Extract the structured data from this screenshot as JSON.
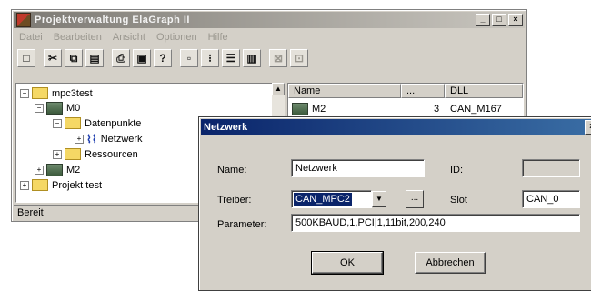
{
  "main_window": {
    "title": "Projektverwaltung ElaGraph II",
    "controls": {
      "minimize": "_",
      "maximize": "□",
      "close": "×"
    },
    "menu": [
      "Datei",
      "Bearbeiten",
      "Ansicht",
      "Optionen",
      "Hilfe"
    ],
    "toolbar_icons": [
      {
        "name": "new-icon",
        "glyph": "□"
      },
      {
        "name": "cut-icon",
        "glyph": "✂"
      },
      {
        "name": "copy-icon",
        "glyph": "⧉"
      },
      {
        "name": "paste-icon",
        "glyph": "▤"
      },
      {
        "name": "print-icon",
        "glyph": "⎙"
      },
      {
        "name": "print-preview-icon",
        "glyph": "▣"
      },
      {
        "name": "help-icon",
        "glyph": "?"
      },
      {
        "name": "large-icons-view-icon",
        "glyph": "▫"
      },
      {
        "name": "small-icons-view-icon",
        "glyph": "⁝"
      },
      {
        "name": "list-view-icon",
        "glyph": "☰"
      },
      {
        "name": "details-view-icon",
        "glyph": "▥"
      },
      {
        "name": "disabled-tool-1-icon",
        "glyph": "⊠"
      },
      {
        "name": "disabled-tool-2-icon",
        "glyph": "⊡"
      }
    ],
    "tree": [
      {
        "label": "mpc3test",
        "icon": "folder-icon",
        "expander": "−"
      },
      {
        "label": "M0",
        "icon": "computer-icon",
        "expander": "−"
      },
      {
        "label": "Datenpunkte",
        "icon": "folder-icon",
        "expander": "−"
      },
      {
        "label": "Netzwerk",
        "icon": "network-icon",
        "expander": "+"
      },
      {
        "label": "Ressourcen",
        "icon": "folder-icon",
        "expander": "+"
      },
      {
        "label": "M2",
        "icon": "computer-icon",
        "expander": "+"
      },
      {
        "label": "Projekt test",
        "icon": "folder-icon",
        "expander": "+"
      }
    ],
    "list": {
      "columns": [
        "Name",
        "...",
        "DLL"
      ],
      "rows": [
        {
          "name": "M2",
          "count": "3",
          "dll": "CAN_M167"
        }
      ]
    },
    "status": "Bereit"
  },
  "dialog": {
    "title": "Netzwerk",
    "close": "×",
    "name_label": "Name:",
    "name_value": "Netzwerk",
    "id_label": "ID:",
    "id_value": "",
    "treiber_label": "Treiber:",
    "treiber_value": "CAN_MPC2",
    "browse_label": "...",
    "slot_label": "Slot",
    "slot_value": "CAN_0",
    "parameter_label": "Parameter:",
    "parameter_value": "500KBAUD,1,PCI|1,11bit,200,240",
    "ok_label": "OK",
    "cancel_label": "Abbrechen"
  }
}
